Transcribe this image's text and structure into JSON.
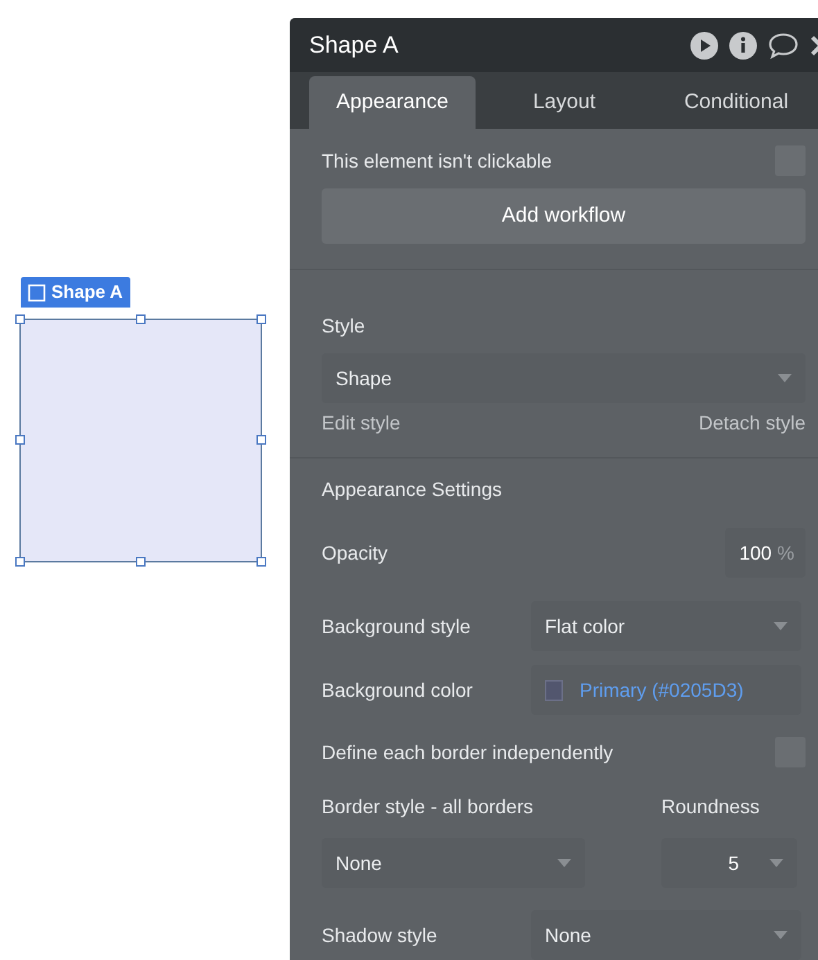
{
  "canvas": {
    "element_label": "Shape A"
  },
  "panel": {
    "title": "Shape A",
    "tabs": [
      {
        "label": "Appearance",
        "selected": true
      },
      {
        "label": "Layout",
        "selected": false
      },
      {
        "label": "Conditional",
        "selected": false
      }
    ],
    "clickable": {
      "label": "This element isn't clickable",
      "checked": false
    },
    "add_workflow": "Add workflow",
    "style": {
      "label": "Style",
      "value": "Shape",
      "edit": "Edit style",
      "detach": "Detach style"
    },
    "appearance": {
      "heading": "Appearance Settings",
      "opacity": {
        "label": "Opacity",
        "value": "100",
        "unit": "%"
      },
      "background_style": {
        "label": "Background style",
        "value": "Flat color"
      },
      "background_color": {
        "label": "Background color",
        "value": "Primary (#0205D3)"
      },
      "independent_borders": {
        "label": "Define each border independently",
        "checked": false
      },
      "border_style": {
        "label": "Border style - all borders",
        "value": "None"
      },
      "roundness": {
        "label": "Roundness",
        "value": "5"
      },
      "shadow_style": {
        "label": "Shadow style",
        "value": "None"
      }
    }
  }
}
